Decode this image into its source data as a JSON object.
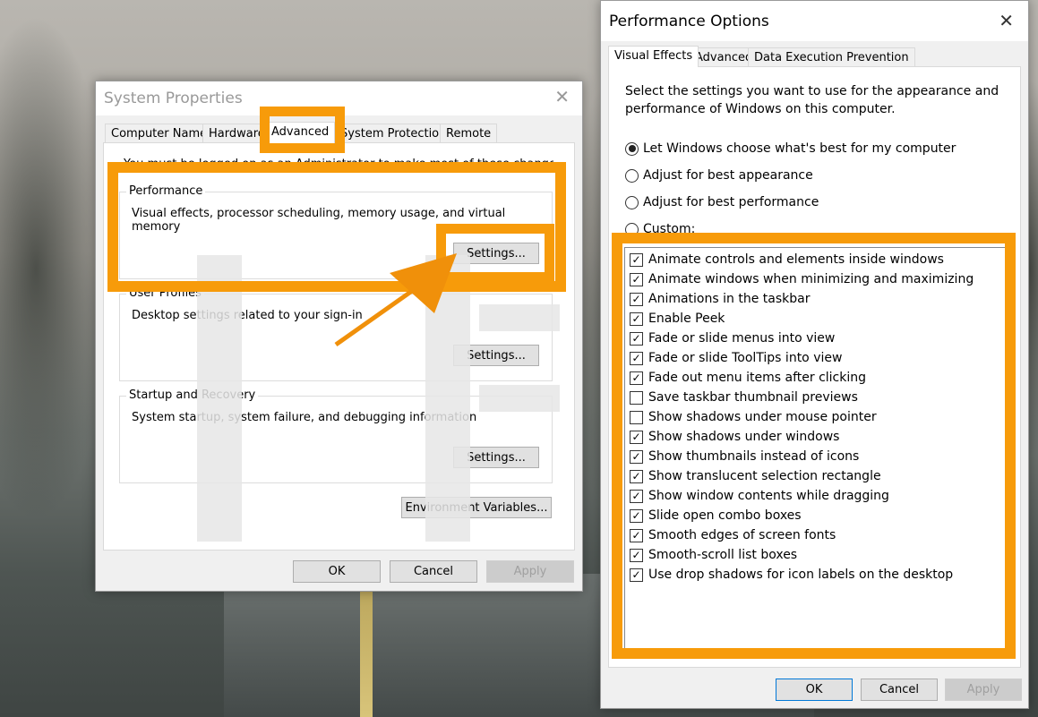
{
  "accent_color": "#f79b0a",
  "system_properties": {
    "title": "System Properties",
    "tabs": [
      "Computer Name",
      "Hardware",
      "Advanced",
      "System Protection",
      "Remote"
    ],
    "selected_tab": "Advanced",
    "intro_partial": "You must be logged on as an Administrator to make most of these changes.",
    "groups": [
      {
        "label": "Performance",
        "desc": "Visual effects, processor scheduling, memory usage, and virtual memory",
        "button": "Settings..."
      },
      {
        "label": "User Profiles",
        "desc": "Desktop settings related to your sign-in",
        "button": "Settings..."
      },
      {
        "label": "Startup and Recovery",
        "desc": "System startup, system failure, and debugging information",
        "button": "Settings..."
      }
    ],
    "env_button": "Environment Variables...",
    "ok": "OK",
    "cancel": "Cancel",
    "apply": "Apply"
  },
  "performance_options": {
    "title": "Performance Options",
    "tabs": [
      "Visual Effects",
      "Advanced",
      "Data Execution Prevention"
    ],
    "selected_tab": "Visual Effects",
    "intro_line1": "Select the settings you want to use for the appearance and",
    "intro_line2": "performance of Windows on this computer.",
    "radios": [
      {
        "label": "Let Windows choose what's best for my computer",
        "checked": true
      },
      {
        "label": "Adjust for best appearance",
        "checked": false
      },
      {
        "label": "Adjust for best performance",
        "checked": false
      },
      {
        "label": "Custom:",
        "checked": false
      }
    ],
    "options": [
      {
        "label": "Animate controls and elements inside windows",
        "checked": true
      },
      {
        "label": "Animate windows when minimizing and maximizing",
        "checked": true
      },
      {
        "label": "Animations in the taskbar",
        "checked": true
      },
      {
        "label": "Enable Peek",
        "checked": true
      },
      {
        "label": "Fade or slide menus into view",
        "checked": true
      },
      {
        "label": "Fade or slide ToolTips into view",
        "checked": true
      },
      {
        "label": "Fade out menu items after clicking",
        "checked": true
      },
      {
        "label": "Save taskbar thumbnail previews",
        "checked": false
      },
      {
        "label": "Show shadows under mouse pointer",
        "checked": false
      },
      {
        "label": "Show shadows under windows",
        "checked": true
      },
      {
        "label": "Show thumbnails instead of icons",
        "checked": true
      },
      {
        "label": "Show translucent selection rectangle",
        "checked": true
      },
      {
        "label": "Show window contents while dragging",
        "checked": true
      },
      {
        "label": "Slide open combo boxes",
        "checked": true
      },
      {
        "label": "Smooth edges of screen fonts",
        "checked": true
      },
      {
        "label": "Smooth-scroll list boxes",
        "checked": true
      },
      {
        "label": "Use drop shadows for icon labels on the desktop",
        "checked": true
      }
    ],
    "ok": "OK",
    "cancel": "Cancel",
    "apply": "Apply"
  }
}
